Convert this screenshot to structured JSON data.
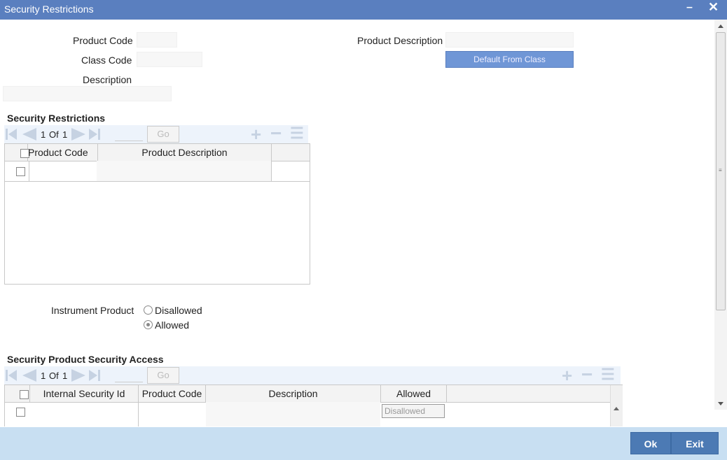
{
  "window": {
    "title": "Security Restrictions"
  },
  "form": {
    "product_code_label": "Product Code",
    "class_code_label": "Class Code",
    "description_label": "Description",
    "product_description_label": "Product Description",
    "default_from_class_label": "Default From Class"
  },
  "security_restrictions": {
    "title": "Security Restrictions",
    "pager": {
      "current": "1",
      "of_label": "Of",
      "total": "1",
      "go_label": "Go"
    },
    "columns": [
      "Product Code",
      "Product Description"
    ]
  },
  "instrument_product": {
    "label": "Instrument Product",
    "options": [
      {
        "label": "Disallowed",
        "selected": false
      },
      {
        "label": "Allowed",
        "selected": true
      }
    ]
  },
  "security_access": {
    "title": "Security Product Security Access",
    "pager": {
      "current": "1",
      "of_label": "Of",
      "total": "1",
      "go_label": "Go"
    },
    "columns": [
      "Internal Security Id",
      "Product Code",
      "Description",
      "Allowed"
    ],
    "row_allowed_value": "Disallowed"
  },
  "footer": {
    "ok_label": "Ok",
    "exit_label": "Exit"
  }
}
